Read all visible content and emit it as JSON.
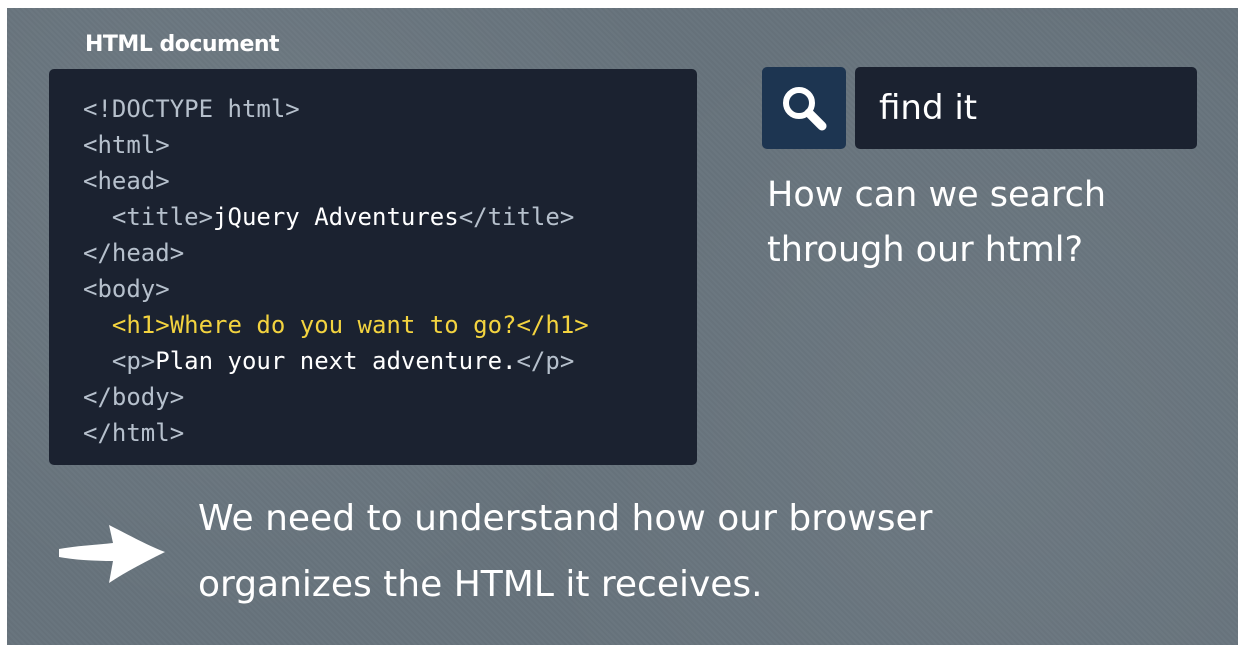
{
  "document_label": "HTML document",
  "code_lines": [
    [
      {
        "cls": "tag",
        "text": "<!DOCTYPE html>"
      }
    ],
    [
      {
        "cls": "tag",
        "text": "<html>"
      }
    ],
    [
      {
        "cls": "tag",
        "text": "<head>"
      }
    ],
    [
      {
        "cls": "tag",
        "text": "  <title>"
      },
      {
        "cls": "txt",
        "text": "jQuery Adventures"
      },
      {
        "cls": "tag",
        "text": "</title>"
      }
    ],
    [
      {
        "cls": "tag",
        "text": "</head>"
      }
    ],
    [
      {
        "cls": "tag",
        "text": "<body>"
      }
    ],
    [
      {
        "cls": "hl",
        "text": "  <h1>Where do you want to go?</h1>"
      }
    ],
    [
      {
        "cls": "tag",
        "text": "  <p>"
      },
      {
        "cls": "txt",
        "text": "Plan your next adventure."
      },
      {
        "cls": "tag",
        "text": "</p>"
      }
    ],
    [
      {
        "cls": "tag",
        "text": "</body>"
      }
    ],
    [
      {
        "cls": "tag",
        "text": "</html>"
      }
    ]
  ],
  "search": {
    "value": "find it",
    "icon": "search-icon"
  },
  "question": "How can we search through our html?",
  "statement_lines": [
    "We need to understand how our browser",
    "organizes the HTML it receives."
  ],
  "arrow_icon": "arrow-right-icon",
  "colors": {
    "background": "#67737c",
    "code_panel": "#1b2230",
    "search_button": "#1d3551",
    "highlight": "#f3d33f",
    "tag": "#b6c0cc"
  }
}
